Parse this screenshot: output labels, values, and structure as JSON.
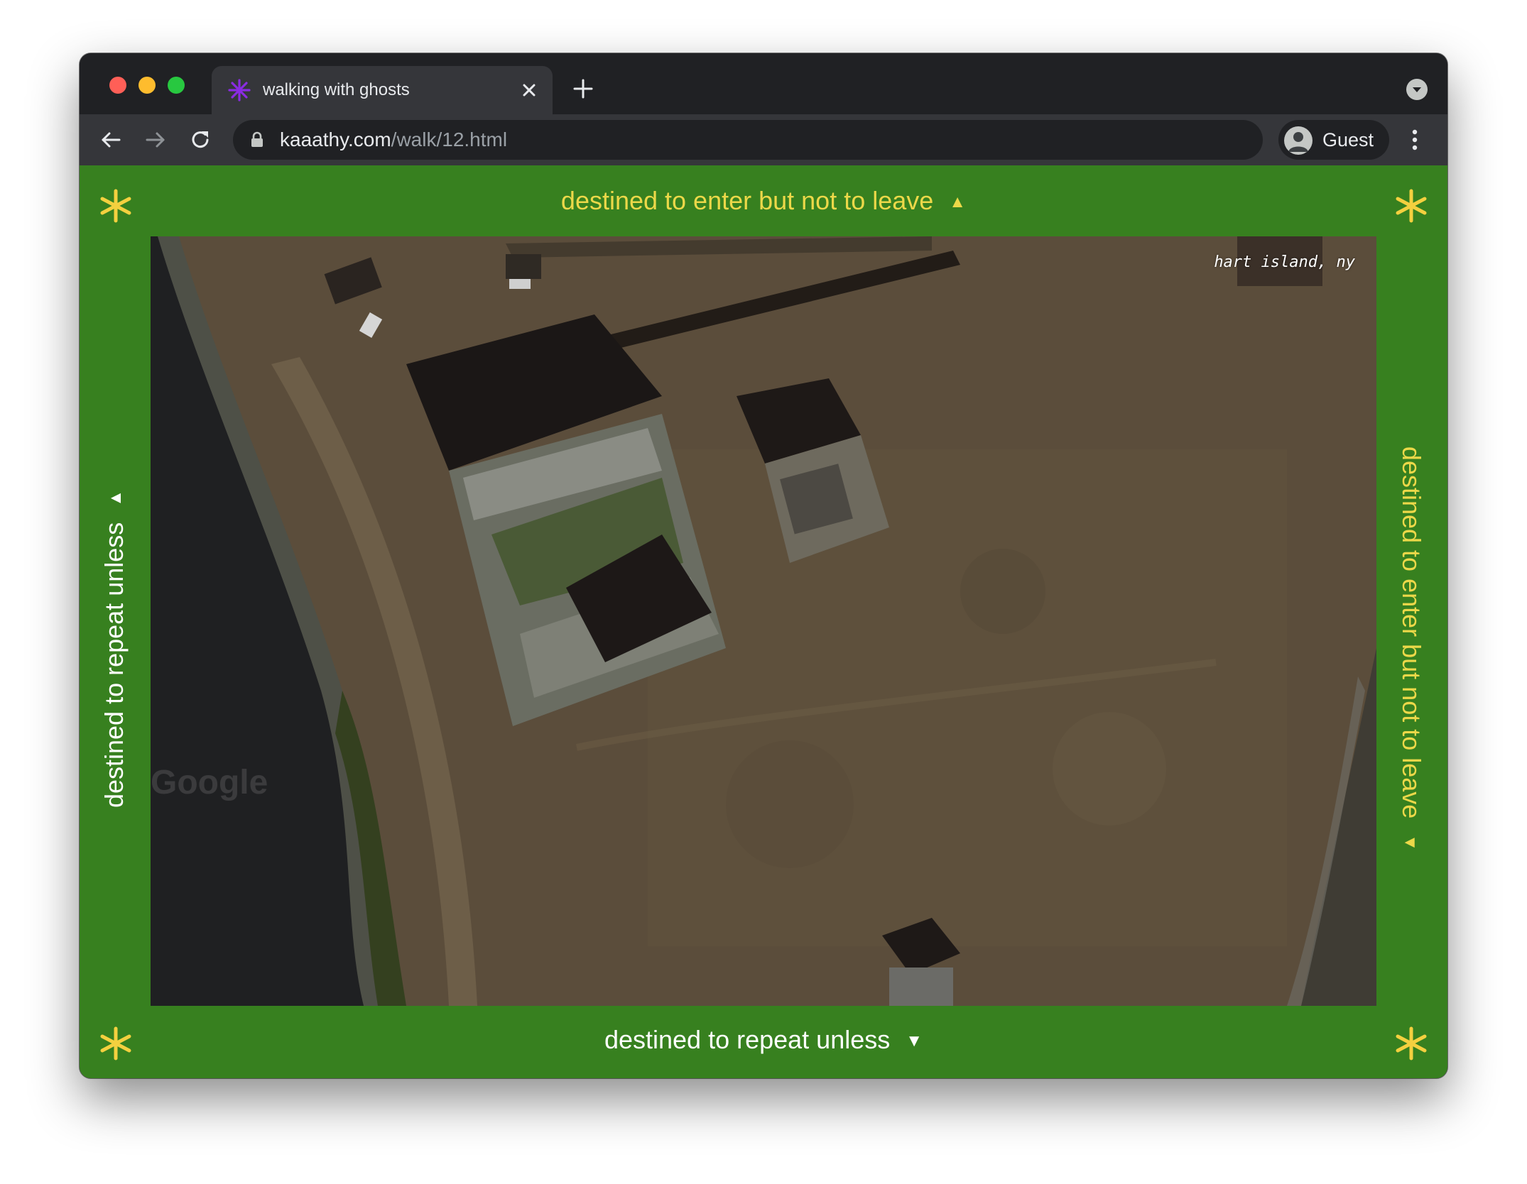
{
  "browser": {
    "tab_title": "walking with ghosts",
    "url_host": "kaaathy.com",
    "url_path": "/walk/12.html",
    "profile_label": "Guest",
    "icons": [
      "back-icon",
      "forward-icon",
      "reload-icon",
      "lock-icon",
      "close-icon",
      "plus-icon",
      "more-vert-icon",
      "tab-search-icon",
      "asterisk-favicon-icon"
    ]
  },
  "page": {
    "caption_top": "destined to enter but not to leave",
    "caption_bottom": "destined to repeat unless",
    "caption_left": "destined to repeat unless",
    "caption_right": "destined to enter but not to leave",
    "arrow_top": "▲",
    "arrow_bottom": "▼",
    "arrow_left": "▲",
    "arrow_right": "▼",
    "photo_label": "hart island, ny",
    "background_color": "#37801f",
    "star_color": "#f4d03f",
    "yellow_text_color": "#ecd849"
  }
}
